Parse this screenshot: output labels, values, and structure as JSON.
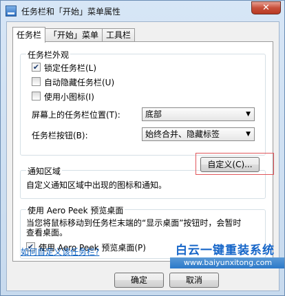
{
  "window": {
    "title": "任务栏和「开始」菜单属性",
    "close_label": "✕"
  },
  "tabs": [
    {
      "label": "任务栏",
      "active": true
    },
    {
      "label": "「开始」菜单",
      "active": false
    },
    {
      "label": "工具栏",
      "active": false
    }
  ],
  "appearance": {
    "title": "任务栏外观",
    "lock": {
      "label": "锁定任务栏(L)",
      "checked": true
    },
    "autohide": {
      "label": "自动隐藏任务栏(U)",
      "checked": false
    },
    "small_icons": {
      "label": "使用小图标(I)",
      "checked": false
    },
    "location": {
      "label": "屏幕上的任务栏位置(T):",
      "value": "底部"
    },
    "buttons": {
      "label": "任务栏按钮(B):",
      "value": "始终合并、隐藏标签"
    }
  },
  "notification": {
    "title": "通知区域",
    "description": "自定义通知区域中出现的图标和通知。",
    "customize_label": "自定义(C)..."
  },
  "aero_peek": {
    "title": "使用 Aero Peek 预览桌面",
    "description_line1": "当您将鼠标移动到任务栏末端的“显示桌面”按钮时，会暂时",
    "description_line2": "查看桌面。",
    "checkbox": {
      "label": "使用 Aero Peek 预览桌面(P)",
      "checked": true
    }
  },
  "help_link": "如何自定义该任务栏?",
  "footer": {
    "ok_label": "确定",
    "cancel_label": "取消"
  },
  "watermark": {
    "text": "白云一键重装系统",
    "url": "www.baiyunxitong.com"
  },
  "colors": {
    "accent": "#1565c8",
    "highlight_box": "#e0555a",
    "link": "#0a5fbf"
  }
}
